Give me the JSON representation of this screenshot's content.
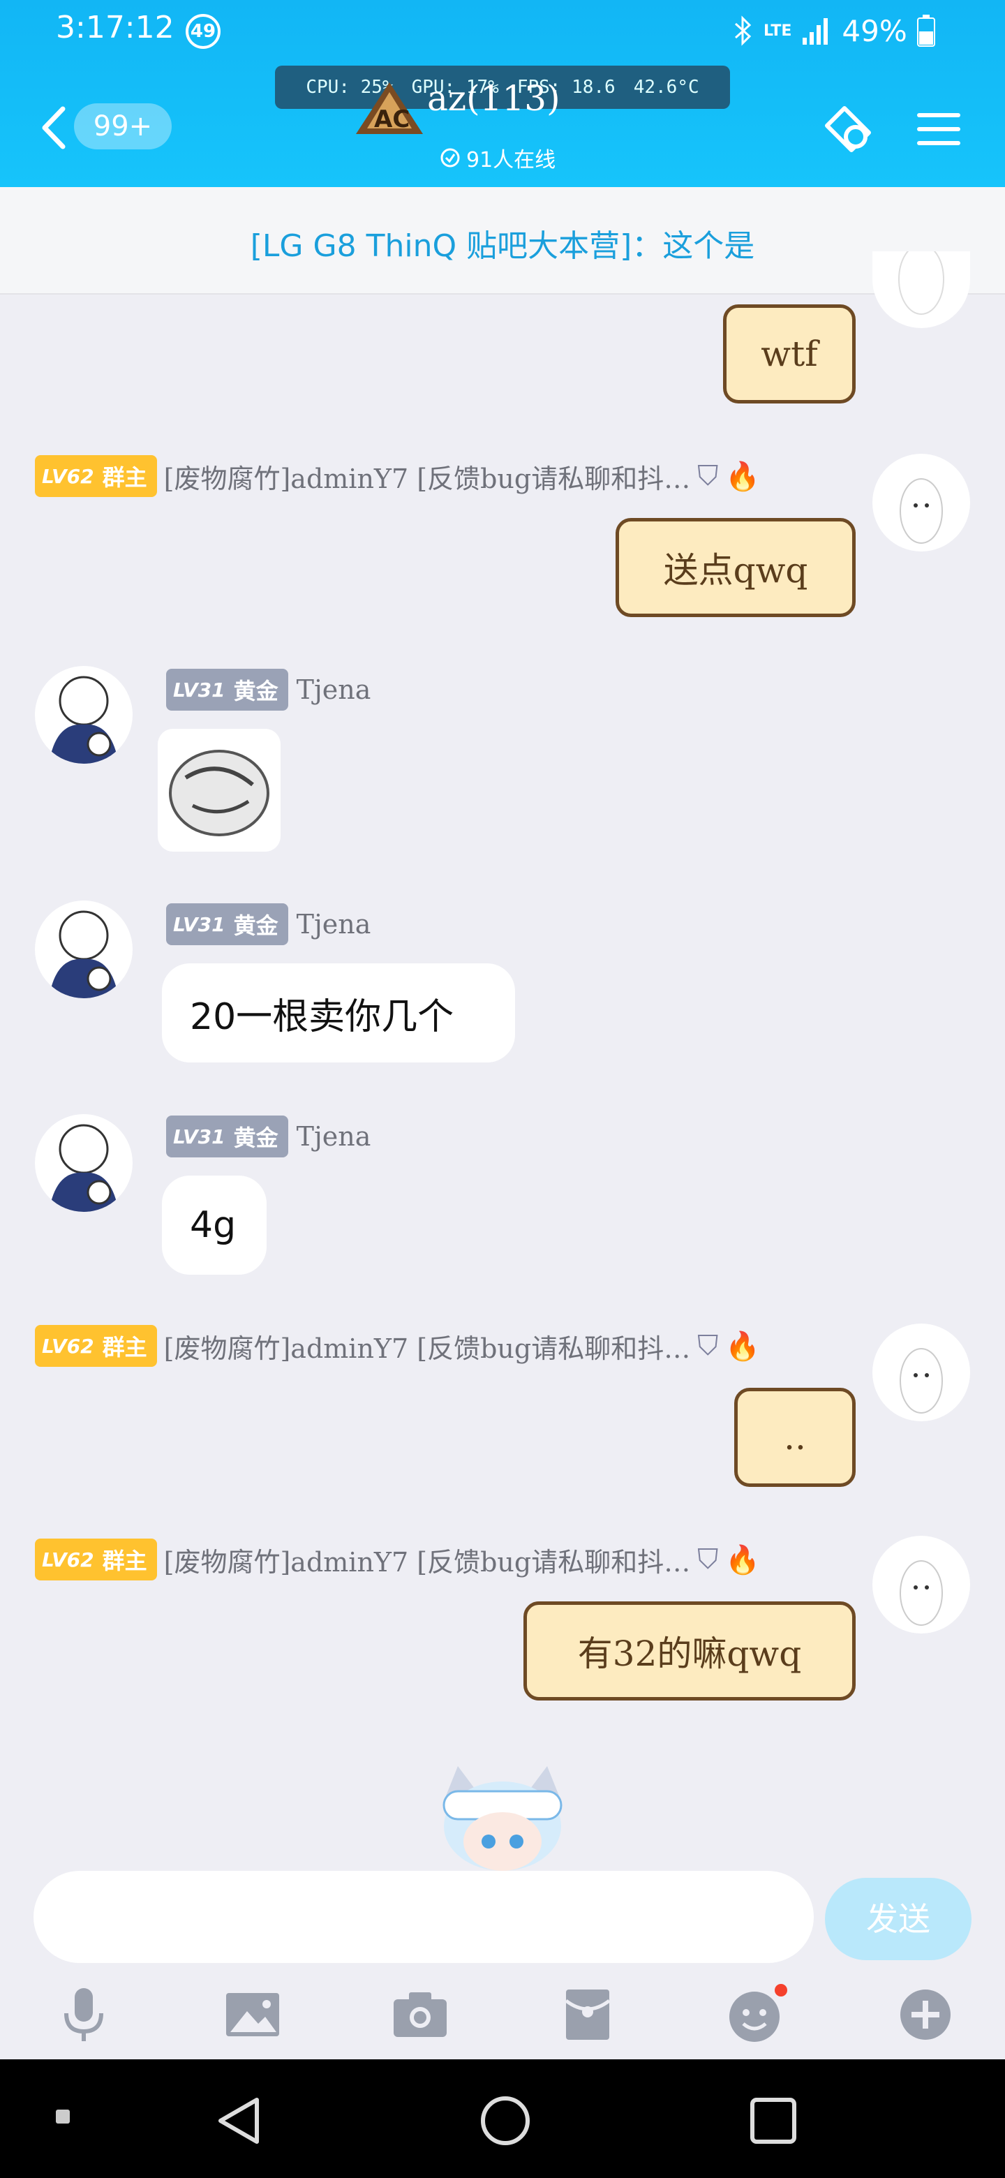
{
  "status_bar": {
    "time": "3:17:12",
    "notification_count": "49",
    "battery": "49%",
    "network": "LTE"
  },
  "perf_overlay": {
    "cpu": "CPU: 25%",
    "gpu": "GPU: 17%",
    "fps": "FPS: 18.6",
    "temp": "42.6°C"
  },
  "header": {
    "unread": "99+",
    "title": "az(113)",
    "online": "91人在线"
  },
  "notice": {
    "text": "[LG G8 ThinQ 贴吧大本营]：这个是"
  },
  "messages": [
    {
      "sender": "[废物腐竹]adminY7 [反馈bug请私聊和抖…",
      "level": "LV62",
      "role": "群主",
      "text": "wtf"
    },
    {
      "sender": "[废物腐竹]adminY7 [反馈bug请私聊和抖…",
      "level": "LV62",
      "role": "群主",
      "text": "送点qwq"
    },
    {
      "sender": "Tjena",
      "level": "LV31",
      "role": "黄金",
      "text": ""
    },
    {
      "sender": "Tjena",
      "level": "LV31",
      "role": "黄金",
      "text": "20一根卖你几个"
    },
    {
      "sender": "Tjena",
      "level": "LV31",
      "role": "黄金",
      "text": "4g"
    },
    {
      "sender": "[废物腐竹]adminY7 [反馈bug请私聊和抖…",
      "level": "LV62",
      "role": "群主",
      "text": ".."
    },
    {
      "sender": "[废物腐竹]adminY7 [反馈bug请私聊和抖…",
      "level": "LV62",
      "role": "群主",
      "text": "有32的嘛qwq"
    }
  ],
  "composer": {
    "placeholder": "",
    "send_label": "发送"
  },
  "icons": [
    "microphone-icon",
    "image-icon",
    "camera-icon",
    "red-packet-icon",
    "emoji-icon",
    "plus-icon"
  ],
  "colors": {
    "header": "#12b6f5",
    "accent": "#1a9fdc",
    "owner_badge": "#ffc22f",
    "gold_badge": "#9aa2b6",
    "cat_bubble": "#fdebc0"
  }
}
